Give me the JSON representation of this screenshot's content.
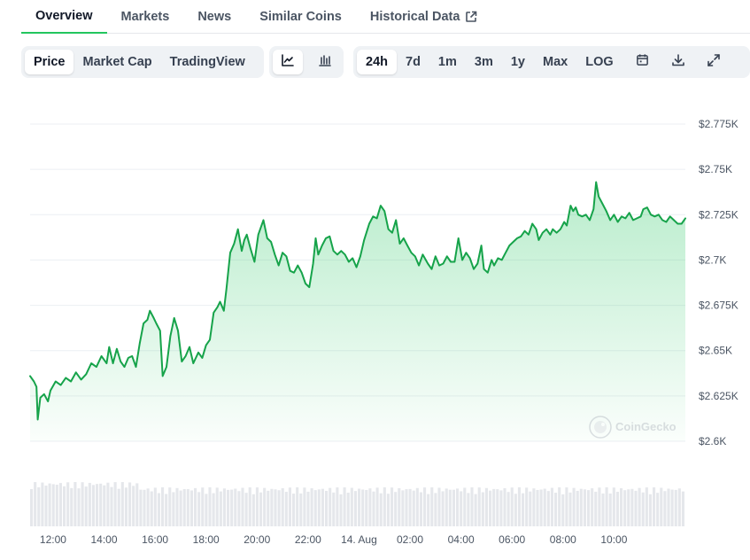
{
  "tabs": [
    {
      "label": "Overview"
    },
    {
      "label": "Markets"
    },
    {
      "label": "News"
    },
    {
      "label": "Similar Coins"
    },
    {
      "label": "Historical Data"
    }
  ],
  "toolbar": {
    "metric": [
      "Price",
      "Market Cap",
      "TradingView"
    ],
    "ranges": [
      "24h",
      "7d",
      "1m",
      "3m",
      "1y",
      "Max",
      "LOG"
    ],
    "active_metric": "Price",
    "active_range": "24h",
    "chart_style_active": "line",
    "icons": [
      "line-chart-icon",
      "candlestick-icon",
      "calendar-icon",
      "download-icon",
      "fullscreen-icon"
    ]
  },
  "watermark": "CoinGecko",
  "colors": {
    "line": "#16a34a",
    "accent": "#22c55e",
    "volume": "#e5e7eb"
  },
  "chart_data": {
    "type": "area",
    "title": "",
    "xlabel": "",
    "ylabel": "",
    "ylim": [
      2.6,
      2.775
    ],
    "yticks": [
      2.6,
      2.625,
      2.65,
      2.675,
      2.7,
      2.725,
      2.75,
      2.775
    ],
    "ytick_labels": [
      "$2.6K",
      "$2.625K",
      "$2.65K",
      "$2.675K",
      "$2.7K",
      "$2.725K",
      "$2.75K",
      "$2.775K"
    ],
    "xlim": [
      -0.9,
      23.2
    ],
    "xticks": [
      0,
      2,
      4,
      6,
      8,
      10,
      12,
      14,
      16,
      18,
      20,
      22
    ],
    "xtick_labels": [
      "12:00",
      "14:00",
      "16:00",
      "18:00",
      "20:00",
      "22:00",
      "14. Aug",
      "02:00",
      "04:00",
      "06:00",
      "08:00",
      "10:00"
    ],
    "grid": true,
    "series": [
      {
        "values": [
          [
            -0.9,
            2.636
          ],
          [
            -0.75,
            2.633
          ],
          [
            -0.65,
            2.63
          ],
          [
            -0.6,
            2.612
          ],
          [
            -0.5,
            2.624
          ],
          [
            -0.35,
            2.626
          ],
          [
            -0.2,
            2.622
          ],
          [
            -0.1,
            2.628
          ],
          [
            0.1,
            2.633
          ],
          [
            0.3,
            2.631
          ],
          [
            0.5,
            2.635
          ],
          [
            0.7,
            2.633
          ],
          [
            0.9,
            2.638
          ],
          [
            1.1,
            2.634
          ],
          [
            1.3,
            2.637
          ],
          [
            1.5,
            2.643
          ],
          [
            1.7,
            2.641
          ],
          [
            1.9,
            2.647
          ],
          [
            2.1,
            2.643
          ],
          [
            2.2,
            2.652
          ],
          [
            2.35,
            2.643
          ],
          [
            2.5,
            2.651
          ],
          [
            2.65,
            2.644
          ],
          [
            2.8,
            2.641
          ],
          [
            2.95,
            2.646
          ],
          [
            3.1,
            2.647
          ],
          [
            3.25,
            2.641
          ],
          [
            3.4,
            2.654
          ],
          [
            3.55,
            2.665
          ],
          [
            3.7,
            2.667
          ],
          [
            3.8,
            2.672
          ],
          [
            3.95,
            2.668
          ],
          [
            4.05,
            2.665
          ],
          [
            4.2,
            2.661
          ],
          [
            4.3,
            2.636
          ],
          [
            4.45,
            2.641
          ],
          [
            4.6,
            2.658
          ],
          [
            4.75,
            2.668
          ],
          [
            4.9,
            2.661
          ],
          [
            5.05,
            2.644
          ],
          [
            5.2,
            2.647
          ],
          [
            5.35,
            2.652
          ],
          [
            5.5,
            2.643
          ],
          [
            5.7,
            2.649
          ],
          [
            5.85,
            2.646
          ],
          [
            6.0,
            2.653
          ],
          [
            6.15,
            2.656
          ],
          [
            6.3,
            2.671
          ],
          [
            6.45,
            2.674
          ],
          [
            6.55,
            2.677
          ],
          [
            6.7,
            2.672
          ],
          [
            6.8,
            2.684
          ],
          [
            6.95,
            2.704
          ],
          [
            7.1,
            2.709
          ],
          [
            7.25,
            2.717
          ],
          [
            7.4,
            2.705
          ],
          [
            7.5,
            2.711
          ],
          [
            7.6,
            2.714
          ],
          [
            7.75,
            2.706
          ],
          [
            7.9,
            2.699
          ],
          [
            8.05,
            2.714
          ],
          [
            8.25,
            2.722
          ],
          [
            8.4,
            2.712
          ],
          [
            8.55,
            2.71
          ],
          [
            8.7,
            2.703
          ],
          [
            8.85,
            2.697
          ],
          [
            9.0,
            2.704
          ],
          [
            9.15,
            2.702
          ],
          [
            9.3,
            2.694
          ],
          [
            9.45,
            2.693
          ],
          [
            9.6,
            2.697
          ],
          [
            9.75,
            2.693
          ],
          [
            9.9,
            2.687
          ],
          [
            10.05,
            2.685
          ],
          [
            10.2,
            2.698
          ],
          [
            10.3,
            2.712
          ],
          [
            10.4,
            2.703
          ],
          [
            10.55,
            2.708
          ],
          [
            10.7,
            2.712
          ],
          [
            10.85,
            2.713
          ],
          [
            11.0,
            2.705
          ],
          [
            11.15,
            2.703
          ],
          [
            11.3,
            2.705
          ],
          [
            11.45,
            2.703
          ],
          [
            11.6,
            2.699
          ],
          [
            11.75,
            2.701
          ],
          [
            11.9,
            2.696
          ],
          [
            12.05,
            2.702
          ],
          [
            12.2,
            2.711
          ],
          [
            12.4,
            2.72
          ],
          [
            12.55,
            2.724
          ],
          [
            12.7,
            2.723
          ],
          [
            12.85,
            2.73
          ],
          [
            13.0,
            2.727
          ],
          [
            13.15,
            2.717
          ],
          [
            13.3,
            2.715
          ],
          [
            13.45,
            2.722
          ],
          [
            13.6,
            2.709
          ],
          [
            13.75,
            2.712
          ],
          [
            13.9,
            2.708
          ],
          [
            14.05,
            2.704
          ],
          [
            14.2,
            2.702
          ],
          [
            14.35,
            2.697
          ],
          [
            14.5,
            2.703
          ],
          [
            14.7,
            2.698
          ],
          [
            14.85,
            2.695
          ],
          [
            15.0,
            2.702
          ],
          [
            15.15,
            2.697
          ],
          [
            15.3,
            2.698
          ],
          [
            15.45,
            2.702
          ],
          [
            15.6,
            2.699
          ],
          [
            15.75,
            2.699
          ],
          [
            15.9,
            2.712
          ],
          [
            16.05,
            2.7
          ],
          [
            16.2,
            2.704
          ],
          [
            16.35,
            2.701
          ],
          [
            16.5,
            2.695
          ],
          [
            16.65,
            2.698
          ],
          [
            16.8,
            2.708
          ],
          [
            16.9,
            2.695
          ],
          [
            17.05,
            2.693
          ],
          [
            17.2,
            2.7
          ],
          [
            17.3,
            2.697
          ],
          [
            17.45,
            2.701
          ],
          [
            17.6,
            2.7
          ],
          [
            17.75,
            2.704
          ],
          [
            17.9,
            2.708
          ],
          [
            18.05,
            2.71
          ],
          [
            18.2,
            2.712
          ],
          [
            18.35,
            2.713
          ],
          [
            18.5,
            2.716
          ],
          [
            18.65,
            2.714
          ],
          [
            18.8,
            2.72
          ],
          [
            18.95,
            2.717
          ],
          [
            19.05,
            2.711
          ],
          [
            19.2,
            2.715
          ],
          [
            19.35,
            2.717
          ],
          [
            19.5,
            2.714
          ],
          [
            19.6,
            2.717
          ],
          [
            19.75,
            2.715
          ],
          [
            19.9,
            2.717
          ],
          [
            20.05,
            2.721
          ],
          [
            20.15,
            2.719
          ],
          [
            20.3,
            2.73
          ],
          [
            20.4,
            2.727
          ],
          [
            20.5,
            2.729
          ],
          [
            20.6,
            2.725
          ],
          [
            20.75,
            2.724
          ],
          [
            20.9,
            2.725
          ],
          [
            21.05,
            2.722
          ],
          [
            21.2,
            2.728
          ],
          [
            21.3,
            2.743
          ],
          [
            21.4,
            2.735
          ],
          [
            21.55,
            2.731
          ],
          [
            21.7,
            2.727
          ],
          [
            21.85,
            2.722
          ],
          [
            22.0,
            2.725
          ],
          [
            22.15,
            2.721
          ],
          [
            22.3,
            2.724
          ],
          [
            22.45,
            2.723
          ],
          [
            22.6,
            2.726
          ],
          [
            22.75,
            2.722
          ],
          [
            22.9,
            2.723
          ],
          [
            23.05,
            2.724
          ],
          [
            23.15,
            2.728
          ],
          [
            23.3,
            2.729
          ],
          [
            23.45,
            2.725
          ],
          [
            23.6,
            2.724
          ],
          [
            23.75,
            2.725
          ],
          [
            23.9,
            2.722
          ],
          [
            24.05,
            2.721
          ],
          [
            24.2,
            2.724
          ],
          [
            24.35,
            2.722
          ],
          [
            24.5,
            2.72
          ],
          [
            24.65,
            2.72
          ],
          [
            24.8,
            2.723
          ]
        ]
      }
    ]
  }
}
